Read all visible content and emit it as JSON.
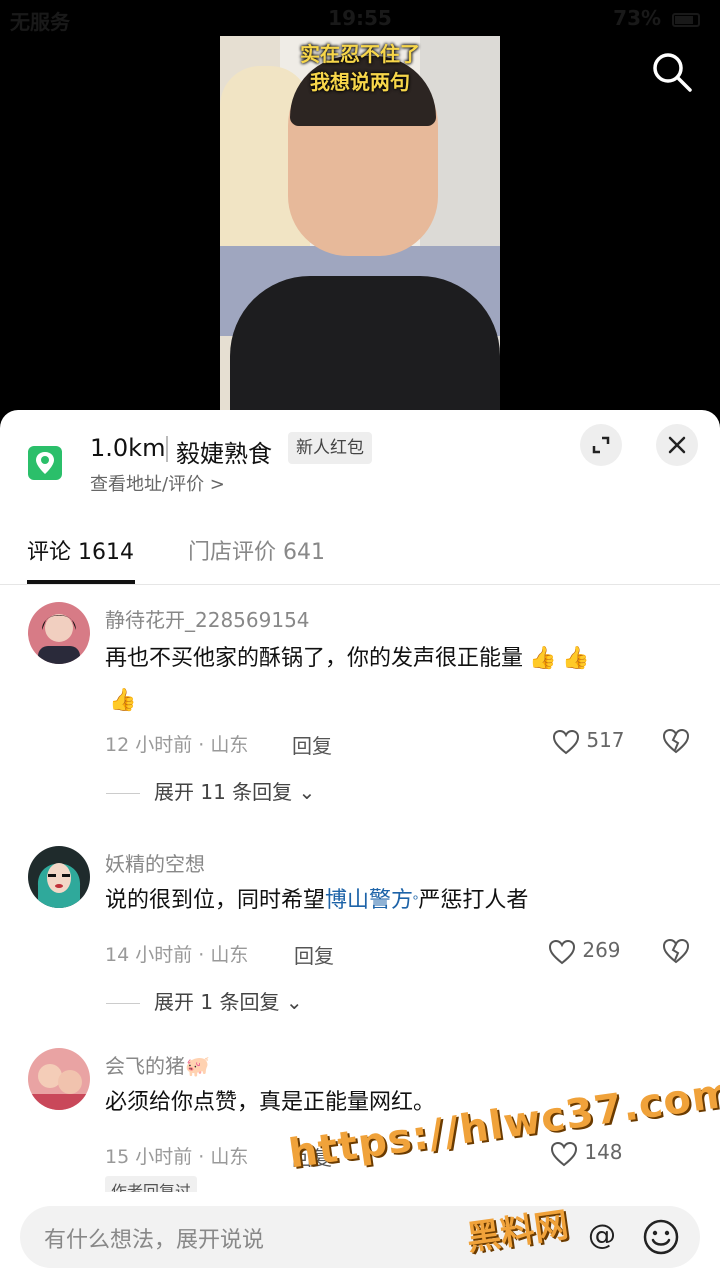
{
  "status_bar": {
    "carrier": "无服务",
    "time": "19:55",
    "battery": "73%"
  },
  "video": {
    "caption_line1": "实在忍不住了",
    "caption_line2": "我想说两句"
  },
  "shop": {
    "distance": "1.0km",
    "name": "毅婕熟食",
    "badge": "新人红包",
    "sub_link": "查看地址/评价 >"
  },
  "tabs": [
    {
      "label": "评论 1614"
    },
    {
      "label": "门店评价 641"
    }
  ],
  "comments": [
    {
      "user": "静待花开_228569154",
      "text": "再也不买他家的酥锅了，你的发声很正能量",
      "meta": "12 小时前 · 山东",
      "reply": "回复",
      "likes": "517",
      "expand": "展开 11 条回复"
    },
    {
      "user": "妖精的空想",
      "text_before": "说的很到位，同时希望",
      "text_link": "博山警方",
      "text_after": "严惩打人者",
      "meta": "14 小时前 · 山东",
      "reply": "回复",
      "likes": "269",
      "expand": "展开 1 条回复"
    },
    {
      "user": "会飞的猪🐖",
      "text": "必须给你点赞，真是正能量网红。",
      "meta": "15 小时前 · 山东",
      "reply": "回复",
      "likes": "148",
      "author_tag": "作者回复过"
    }
  ],
  "input": {
    "placeholder": "有什么想法，展开说说"
  },
  "watermark": {
    "url": "https://hlwc37.com",
    "site": "黑料网"
  },
  "icons": {
    "search": "search-icon",
    "location": "location-pin-icon",
    "expand": "expand-icon",
    "close": "close-icon",
    "like": "heart-icon",
    "dislike": "broken-heart-icon",
    "at": "at-icon",
    "emoji": "emoji-icon"
  }
}
